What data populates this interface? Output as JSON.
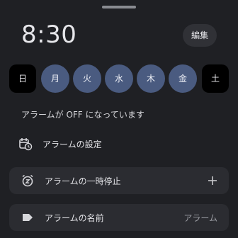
{
  "header": {
    "time": "8:30",
    "edit_label": "編集"
  },
  "days": [
    {
      "label": "日",
      "selected": false
    },
    {
      "label": "月",
      "selected": true
    },
    {
      "label": "火",
      "selected": true
    },
    {
      "label": "水",
      "selected": true
    },
    {
      "label": "木",
      "selected": true
    },
    {
      "label": "金",
      "selected": true
    },
    {
      "label": "土",
      "selected": false
    }
  ],
  "status_text": "アラームが OFF になっています",
  "schedule": {
    "label": "アラームの設定",
    "icon": "calendar-clock-icon"
  },
  "pause": {
    "label": "アラームの一時停止",
    "icon": "alarm-snooze-icon",
    "action_icon": "plus-icon"
  },
  "name": {
    "label": "アラームの名前",
    "value": "アラーム",
    "icon": "label-tag-icon"
  },
  "colors": {
    "background": "#1f2024",
    "selected_day": "#4a5b80",
    "card": "#2b2c31"
  }
}
